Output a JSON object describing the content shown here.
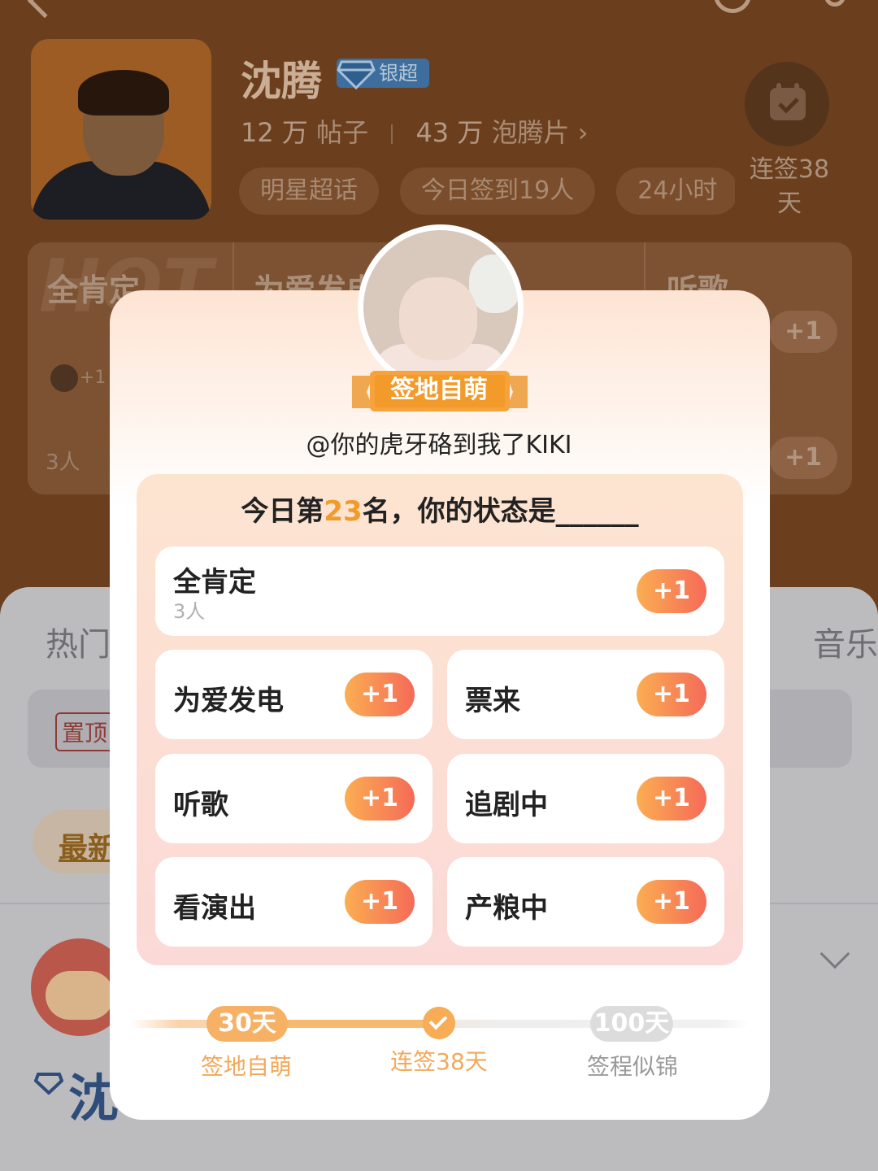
{
  "background": {
    "star_name": "沈腾",
    "rank_badge": "银超",
    "posts_count": "12 万",
    "posts_label": "帖子",
    "fans_count": "43 万",
    "fans_label": "泡腾片 ›",
    "tags": [
      "明星超话",
      "今日签到19人",
      "24小时"
    ],
    "streak_label": "连签38天",
    "strip": {
      "col1": "全肯定",
      "col1_count": "3人",
      "col1_plus": "+1",
      "col2": "为爱发电",
      "col3": "听歌",
      "plus": "+1"
    },
    "tabs": {
      "hot": "热门",
      "music": "音乐"
    },
    "pin_tag": "置顶",
    "latest": "最新",
    "post_name": "沈"
  },
  "modal": {
    "badge": "签地自萌",
    "handle": "@你的虎牙硌到我了KIKI",
    "status_prefix": "今日第",
    "rank": "23",
    "status_suffix": "名，你的状态是______",
    "options": [
      {
        "label": "全肯定",
        "count": "3人",
        "plus": "+1"
      },
      {
        "label": "为爱发电",
        "plus": "+1"
      },
      {
        "label": "票来",
        "plus": "+1"
      },
      {
        "label": "听歌",
        "plus": "+1"
      },
      {
        "label": "追剧中",
        "plus": "+1"
      },
      {
        "label": "看演出",
        "plus": "+1"
      },
      {
        "label": "产粮中",
        "plus": "+1"
      }
    ],
    "progress": {
      "milestone_1": "30天",
      "milestone_1_label": "签地自萌",
      "current_label": "连签38天",
      "milestone_3": "100天",
      "milestone_3_label": "签程似锦",
      "current_days": 38
    }
  },
  "colors": {
    "accent": "#f29a2a",
    "button_start": "#fbae52",
    "button_end": "#f56a58"
  }
}
